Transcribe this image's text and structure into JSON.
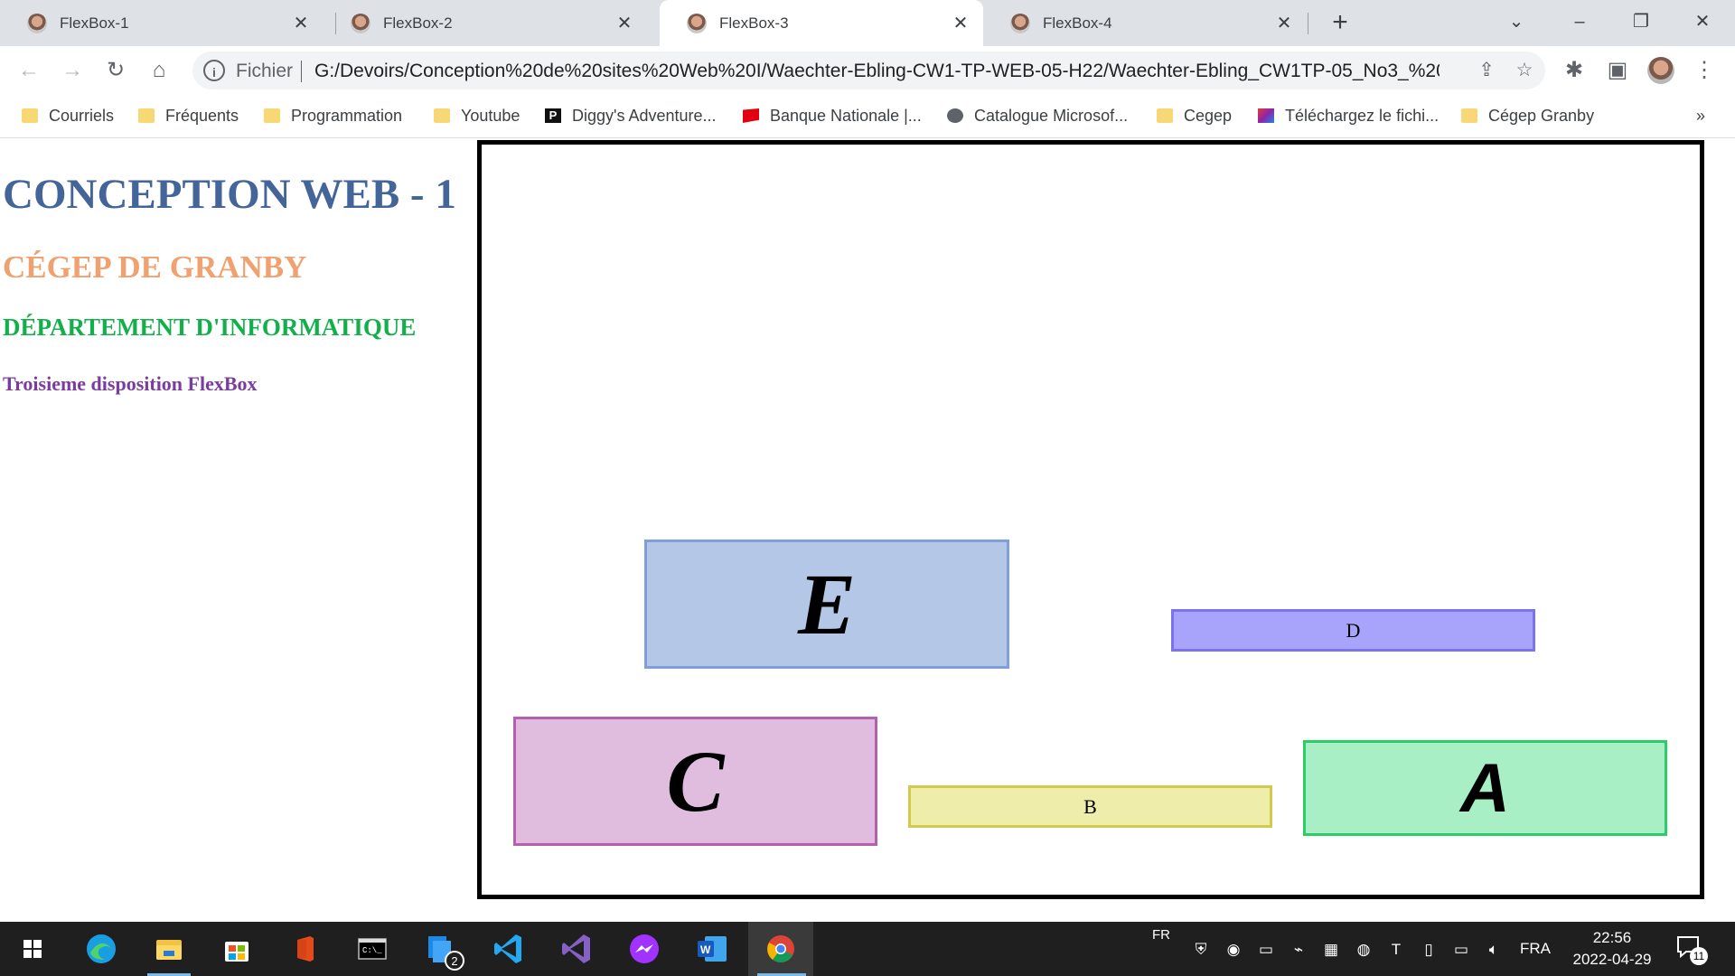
{
  "browser": {
    "tabs": [
      {
        "title": "FlexBox-1",
        "active": false
      },
      {
        "title": "FlexBox-2",
        "active": false
      },
      {
        "title": "FlexBox-3",
        "active": true
      },
      {
        "title": "FlexBox-4",
        "active": false
      }
    ],
    "address": {
      "scheme_label": "Fichier",
      "url": "G:/Devoirs/Conception%20de%20sites%20Web%20I/Waechter-Ebling-CW1-TP-WEB-05-H22/Waechter-Ebling_CW1TP-05_No3_%20fle..."
    },
    "bookmarks": [
      {
        "label": "Courriels",
        "icon": "folder-icon"
      },
      {
        "label": "Fréquents",
        "icon": "folder-icon"
      },
      {
        "label": "Programmation",
        "icon": "folder-icon"
      },
      {
        "label": "Youtube",
        "icon": "folder-icon"
      },
      {
        "label": "Diggy's Adventure...",
        "icon": "diggy-icon"
      },
      {
        "label": "Banque Nationale |...",
        "icon": "bank-flag-icon"
      },
      {
        "label": "Catalogue Microsof...",
        "icon": "globe-icon"
      },
      {
        "label": "Cegep",
        "icon": "folder-icon"
      },
      {
        "label": "Téléchargez le fichi...",
        "icon": "download-site-icon"
      },
      {
        "label": "Cégep Granby",
        "icon": "folder-icon"
      }
    ],
    "more_bookmarks": "»"
  },
  "page": {
    "title": "CONCEPTION WEB - 1",
    "subtitle": "CÉGEP DE GRANBY",
    "department": "DÉPARTEMENT D'INFORMATIQUE",
    "caption": "Troisieme disposition FlexBox",
    "boxes": {
      "e": "E",
      "d": "D",
      "c": "C",
      "b": "B",
      "a": "A"
    },
    "colors": {
      "e": "#b4c7e7",
      "e_border": "#7f9fdc",
      "d": "#a8a3fb",
      "d_border": "#7b72f2",
      "c": "#e0bcdf",
      "c_border": "#b65fae",
      "b": "#eeeeaa",
      "b_border": "#d3c94c",
      "a": "#a9efc6",
      "a_border": "#2ccc66"
    }
  },
  "taskbar": {
    "apps": [
      "start-icon",
      "edge-icon",
      "file-explorer-icon",
      "store-icon",
      "office-icon",
      "terminal-icon",
      "task-view-icon",
      "vscode-icon",
      "visual-studio-icon",
      "messenger-icon",
      "word-icon",
      "chrome-icon"
    ],
    "task_view_badge": "2",
    "keyboard_layout_short": "FR",
    "language": "FRA",
    "time": "22:56",
    "date": "2022-04-29",
    "notifications": "11"
  }
}
